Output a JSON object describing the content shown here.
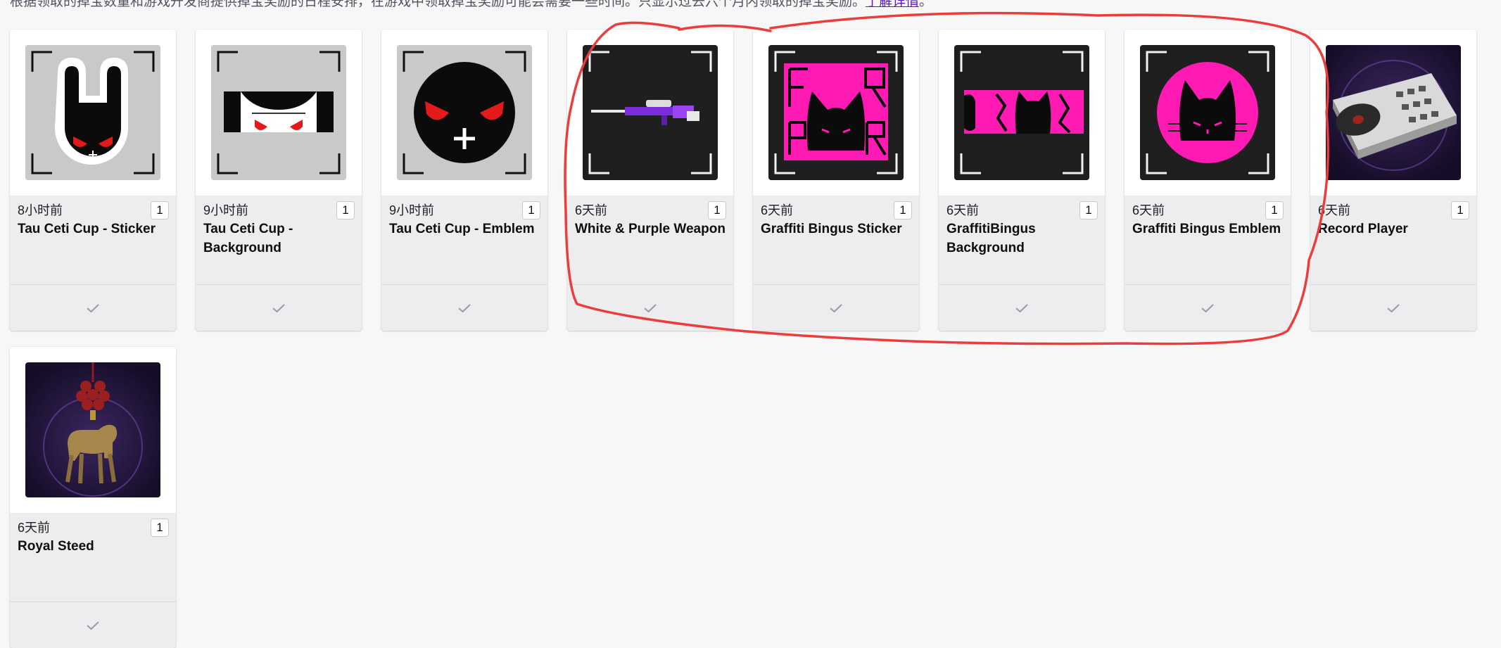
{
  "notice": {
    "text": "根据领取的掉宝数量和游戏开发商提供掉宝奖励的日程安排，在游戏中领取掉宝奖励可能会需要一些时间。只显示过去六个月内领取的掉宝奖励。",
    "link_label": "了解详情",
    "tail": "。"
  },
  "rewards": [
    {
      "time": "8小时前",
      "count": "1",
      "title": "Tau Ceti Cup - Sticker",
      "icon": "white-rabbit-sticker-icon"
    },
    {
      "time": "9小时前",
      "count": "1",
      "title": "Tau Ceti Cup - Background",
      "icon": "rabbit-background-icon"
    },
    {
      "time": "9小时前",
      "count": "1",
      "title": "Tau Ceti Cup - Emblem",
      "icon": "black-emblem-icon"
    },
    {
      "time": "6天前",
      "count": "1",
      "title": "White & Purple Weapon",
      "icon": "purple-rifle-icon"
    },
    {
      "time": "6天前",
      "count": "1",
      "title": "Graffiti Bingus Sticker",
      "icon": "graffiti-cat-sticker-icon"
    },
    {
      "time": "6天前",
      "count": "1",
      "title": "GraffitiBingus Background",
      "icon": "graffiti-cat-background-icon"
    },
    {
      "time": "6天前",
      "count": "1",
      "title": "Graffiti Bingus Emblem",
      "icon": "pink-cat-emblem-icon"
    },
    {
      "time": "6天前",
      "count": "1",
      "title": "Record Player",
      "icon": "record-player-icon"
    },
    {
      "time": "6天前",
      "count": "1",
      "title": "Royal Steed",
      "icon": "royal-steed-icon"
    }
  ],
  "icons": {
    "claimed": "check-icon"
  },
  "colors": {
    "link": "#5c16c5",
    "annotation": "#ec3d3d",
    "neon_pink": "#ff1ab4"
  }
}
